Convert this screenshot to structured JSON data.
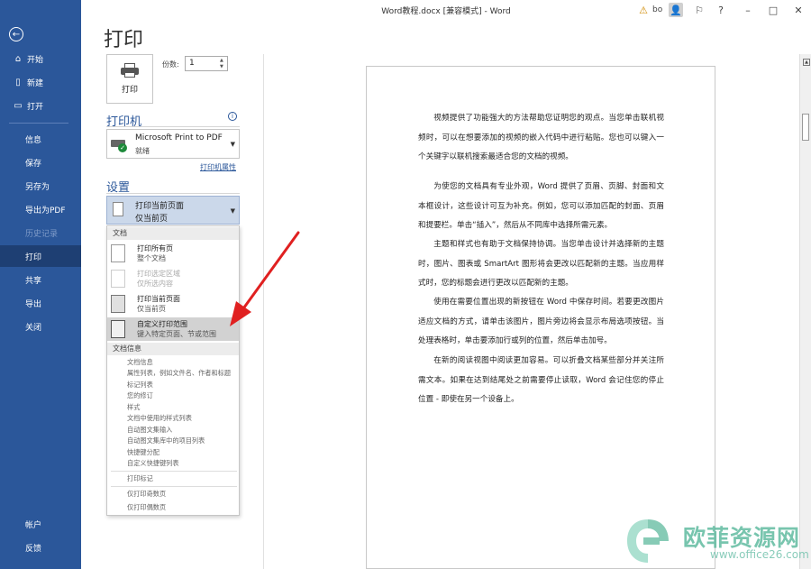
{
  "window": {
    "title": "Word教程.docx [兼容模式] - Word",
    "user": "bo"
  },
  "sidebar": {
    "items": [
      {
        "label": "开始",
        "icon": "home-icon"
      },
      {
        "label": "新建",
        "icon": "new-doc-icon"
      },
      {
        "label": "打开",
        "icon": "folder-open-icon"
      },
      {
        "label": "信息"
      },
      {
        "label": "保存"
      },
      {
        "label": "另存为"
      },
      {
        "label": "导出为PDF"
      },
      {
        "label": "历史记录"
      },
      {
        "label": "打印"
      },
      {
        "label": "共享"
      },
      {
        "label": "导出"
      },
      {
        "label": "关闭"
      }
    ],
    "bottom": [
      {
        "label": "帐户"
      },
      {
        "label": "反馈"
      }
    ]
  },
  "page_title": "打印",
  "print_button_label": "打印",
  "copies": {
    "label": "份数:",
    "value": "1"
  },
  "printer": {
    "heading": "打印机",
    "name": "Microsoft Print to PDF",
    "status": "就绪",
    "properties_link": "打印机属性"
  },
  "settings": {
    "heading": "设置",
    "selected_line1": "打印当前页面",
    "selected_line2": "仅当前页"
  },
  "menu": {
    "group_documents": "文档",
    "items": [
      {
        "title": "打印所有页",
        "desc": "整个文档"
      },
      {
        "title": "打印选定区域",
        "desc": "仅所选内容"
      },
      {
        "title": "打印当前页面",
        "desc": "仅当前页"
      },
      {
        "title": "自定义打印范围",
        "desc": "键入特定页面、节或范围"
      }
    ],
    "group_info": "文档信息",
    "info_items": [
      "文档信息",
      "属性列表，例如文件名、作者和标题",
      "标记列表",
      "您的修订",
      "样式",
      "文档中使用的样式列表",
      "自动图文集输入",
      "自动图文集库中的项目列表",
      "快捷键分配",
      "自定义快捷键列表"
    ],
    "extra_items": [
      "打印标记",
      "仅打印奇数页",
      "仅打印偶数页"
    ]
  },
  "document": {
    "paragraphs": [
      "视频提供了功能强大的方法帮助您证明您的观点。当您单击联机视频时，可以在想要添加的视频的嵌入代码中进行粘贴。您也可以键入一个关键字以联机搜索最适合您的文档的视频。",
      "为使您的文档具有专业外观，Word 提供了页眉、页脚、封面和文本框设计，这些设计可互为补充。例如，您可以添加匹配的封面、页眉和提要栏。单击“插入”，然后从不同库中选择所需元素。",
      "主题和样式也有助于文档保持协调。当您单击设计并选择新的主题时，图片、图表或 SmartArt 图形将会更改以匹配新的主题。当应用样式时，您的标题会进行更改以匹配新的主题。",
      "使用在需要位置出现的新按钮在 Word 中保存时间。若要更改图片适应文档的方式，请单击该图片，图片旁边将会显示布局选项按钮。当处理表格时，单击要添加行或列的位置，然后单击加号。",
      "在新的阅读视图中阅读更加容易。可以折叠文档某些部分并关注所需文本。如果在达到结尾处之前需要停止读取，Word 会记住您的停止位置 - 即使在另一个设备上。"
    ]
  },
  "watermark": {
    "cn": "欧菲资源网",
    "en": "www.office26.com"
  },
  "colors": {
    "sidebar": "#2b579a",
    "accent": "#2b579a",
    "arrow": "#e02020"
  }
}
